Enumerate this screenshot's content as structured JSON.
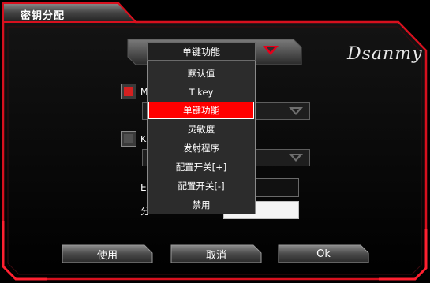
{
  "window": {
    "title": "密钥分配",
    "brand": "Dsanmy"
  },
  "key_function": {
    "selected": "单键功能",
    "options": [
      "默认值",
      "T key",
      "单键功能",
      "灵敏度",
      "发射程序",
      "配置开关[+]",
      "配置开关[-]",
      "禁用"
    ],
    "selected_index": 2
  },
  "hidden_labels": {
    "checkbox1": "M",
    "checkbox2": "K",
    "field1": "E",
    "field2": "分"
  },
  "buttons": {
    "use": "使用",
    "cancel": "取消",
    "ok": "Ok"
  },
  "colors": {
    "accent": "#e4001b",
    "selected_bg": "#ff0000",
    "panel": "#2c2c2c",
    "background": "#000000"
  }
}
